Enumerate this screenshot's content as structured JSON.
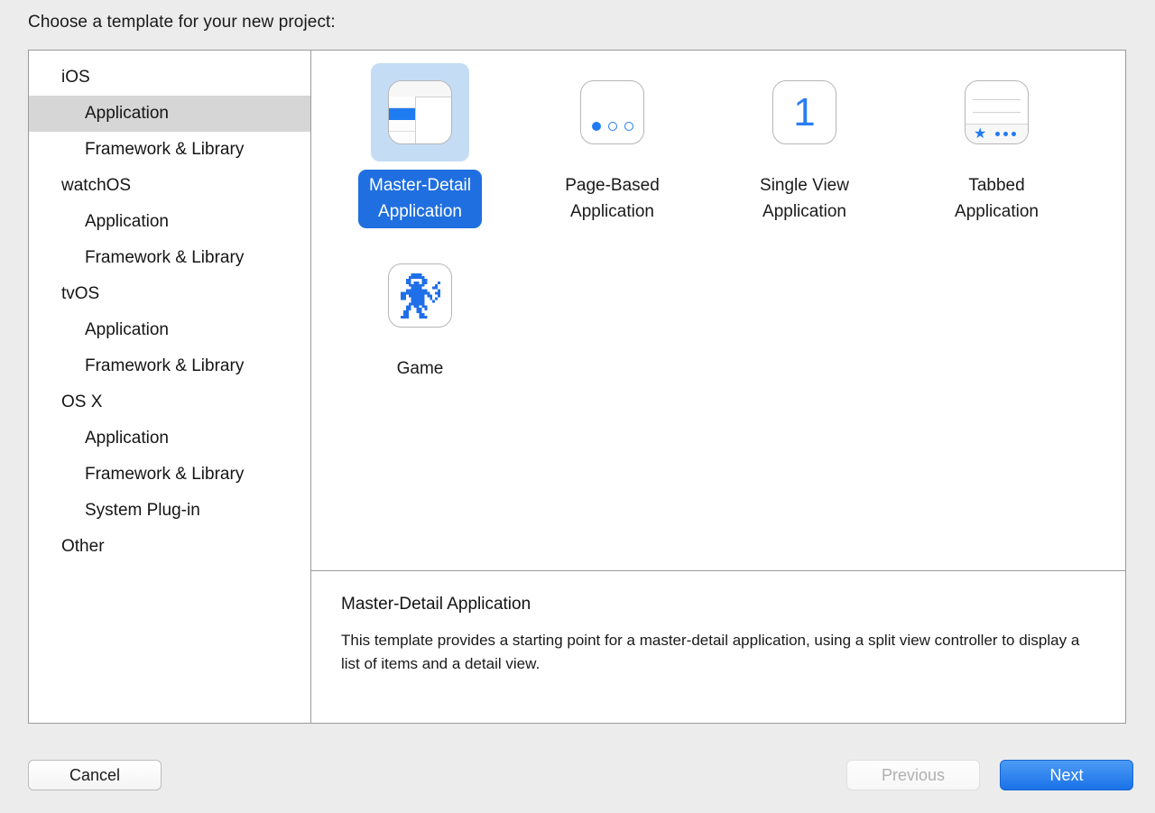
{
  "prompt": "Choose a template for your new project:",
  "sidebar": {
    "items": [
      {
        "label": "iOS",
        "level": "group",
        "selected": false
      },
      {
        "label": "Application",
        "level": "child",
        "selected": true
      },
      {
        "label": "Framework & Library",
        "level": "child",
        "selected": false
      },
      {
        "label": "watchOS",
        "level": "group",
        "selected": false
      },
      {
        "label": "Application",
        "level": "child",
        "selected": false
      },
      {
        "label": "Framework & Library",
        "level": "child",
        "selected": false
      },
      {
        "label": "tvOS",
        "level": "group",
        "selected": false
      },
      {
        "label": "Application",
        "level": "child",
        "selected": false
      },
      {
        "label": "Framework & Library",
        "level": "child",
        "selected": false
      },
      {
        "label": "OS X",
        "level": "group",
        "selected": false
      },
      {
        "label": "Application",
        "level": "child",
        "selected": false
      },
      {
        "label": "Framework & Library",
        "level": "child",
        "selected": false
      },
      {
        "label": "System Plug-in",
        "level": "child",
        "selected": false
      },
      {
        "label": "Other",
        "level": "group",
        "selected": false
      }
    ]
  },
  "templates": [
    {
      "label": "Master-Detail\nApplication",
      "line1": "Master-Detail",
      "line2": "Application",
      "icon": "master-detail-icon",
      "selected": true
    },
    {
      "label": "Page-Based\nApplication",
      "line1": "Page-Based",
      "line2": "Application",
      "icon": "page-based-icon",
      "selected": false
    },
    {
      "label": "Single View\nApplication",
      "line1": "Single View",
      "line2": "Application",
      "icon": "single-view-icon",
      "selected": false
    },
    {
      "label": "Tabbed\nApplication",
      "line1": "Tabbed",
      "line2": "Application",
      "icon": "tabbed-icon",
      "selected": false
    },
    {
      "label": "Game",
      "line1": "Game",
      "line2": "",
      "icon": "game-robot-icon",
      "selected": false
    }
  ],
  "description": {
    "title": "Master-Detail Application",
    "body": "This template provides a starting point for a master-detail application, using a split view controller to display a list of items and a detail view."
  },
  "single_view_glyph": "1",
  "footer": {
    "cancel": "Cancel",
    "previous": "Previous",
    "next": "Next"
  },
  "colors": {
    "accent_blue": "#1f6fe0",
    "icon_blue": "#1f7bf0",
    "selection_halo": "#c5dcf5",
    "sidebar_selected": "#d6d6d6",
    "window_bg": "#ececec",
    "next_button": "#1a72e8"
  }
}
